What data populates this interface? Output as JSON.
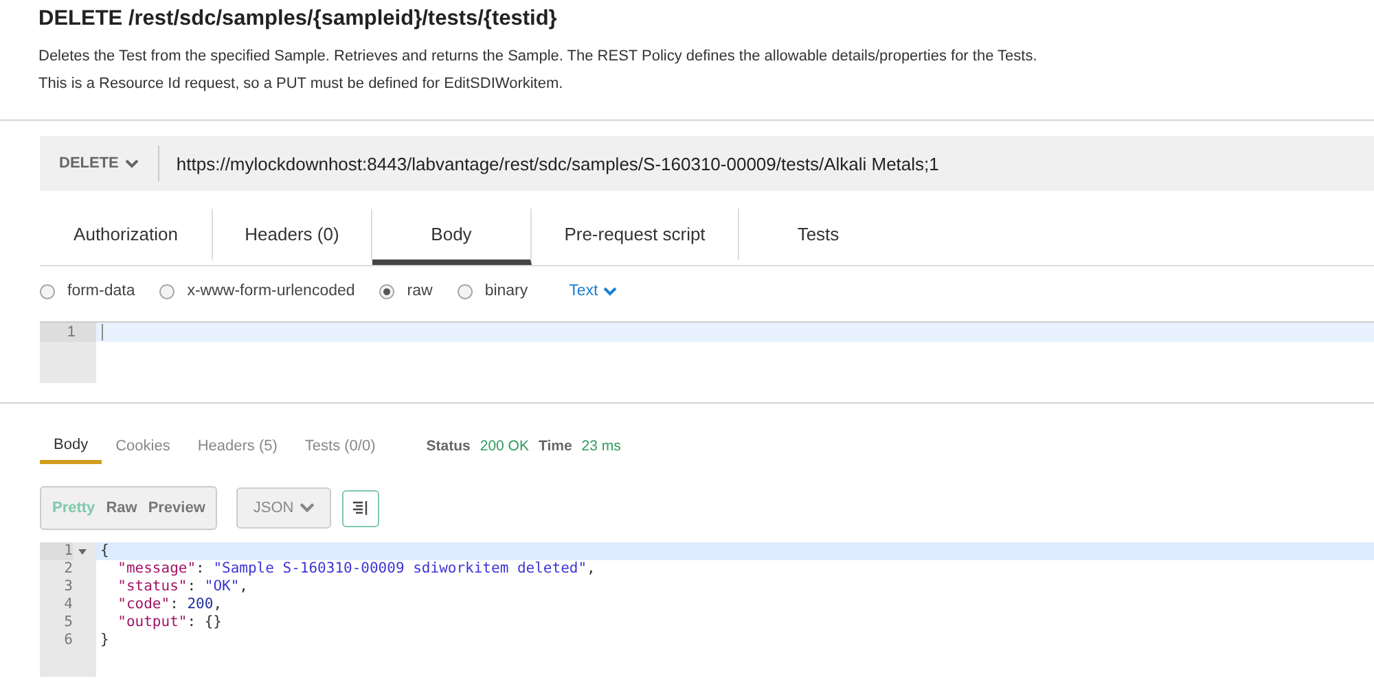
{
  "endpoint": {
    "title": "DELETE /rest/sdc/samples/{sampleid}/tests/{testid}",
    "description": "Deletes the Test from the specified Sample. Retrieves and returns the Sample. The REST Policy defines the allowable details/properties for the Tests. This is a Resource Id request, so a PUT must be defined for EditSDIWorkitem."
  },
  "request": {
    "method": "DELETE",
    "url": "https://mylockdownhost:8443/labvantage/rest/sdc/samples/S-160310-00009/tests/Alkali Metals;1",
    "tabs": [
      {
        "label": "Authorization",
        "selected": false
      },
      {
        "label": "Headers (0)",
        "selected": false
      },
      {
        "label": "Body",
        "selected": true
      },
      {
        "label": "Pre-request script",
        "selected": false
      },
      {
        "label": "Tests",
        "selected": false
      }
    ],
    "body_modes": [
      {
        "label": "form-data",
        "selected": false
      },
      {
        "label": "x-www-form-urlencoded",
        "selected": false
      },
      {
        "label": "raw",
        "selected": true
      },
      {
        "label": "binary",
        "selected": false
      }
    ],
    "content_type": "Text",
    "editor_lines": [
      "1"
    ]
  },
  "response": {
    "tabs": [
      {
        "label": "Body",
        "selected": true
      },
      {
        "label": "Cookies",
        "selected": false
      },
      {
        "label": "Headers (5)",
        "selected": false
      },
      {
        "label": "Tests (0/0)",
        "selected": false
      }
    ],
    "status_label": "Status",
    "status": "200 OK",
    "time_label": "Time",
    "time": "23 ms",
    "views": [
      {
        "label": "Pretty",
        "selected": true
      },
      {
        "label": "Raw",
        "selected": false
      },
      {
        "label": "Preview",
        "selected": false
      }
    ],
    "format": "JSON",
    "lines": [
      {
        "number": "1",
        "fold": true,
        "active": true,
        "tokens": [
          {
            "t": "{",
            "kind": "punct"
          }
        ]
      },
      {
        "number": "2",
        "fold": false,
        "active": false,
        "tokens": [
          {
            "t": "  \"message\"",
            "kind": "key"
          },
          {
            "t": ": ",
            "kind": "punct"
          },
          {
            "t": "\"Sample S-160310-00009 sdiworkitem deleted\"",
            "kind": "string"
          },
          {
            "t": ",",
            "kind": "punct"
          }
        ]
      },
      {
        "number": "3",
        "fold": false,
        "active": false,
        "tokens": [
          {
            "t": "  \"status\"",
            "kind": "key"
          },
          {
            "t": ": ",
            "kind": "punct"
          },
          {
            "t": "\"OK\"",
            "kind": "string"
          },
          {
            "t": ",",
            "kind": "punct"
          }
        ]
      },
      {
        "number": "4",
        "fold": false,
        "active": false,
        "tokens": [
          {
            "t": "  \"code\"",
            "kind": "key"
          },
          {
            "t": ": ",
            "kind": "punct"
          },
          {
            "t": "200",
            "kind": "number"
          },
          {
            "t": ",",
            "kind": "punct"
          }
        ]
      },
      {
        "number": "5",
        "fold": false,
        "active": false,
        "tokens": [
          {
            "t": "  \"output\"",
            "kind": "key"
          },
          {
            "t": ": {}",
            "kind": "punct"
          }
        ]
      },
      {
        "number": "6",
        "fold": false,
        "active": false,
        "tokens": [
          {
            "t": "}",
            "kind": "punct"
          }
        ]
      }
    ]
  }
}
